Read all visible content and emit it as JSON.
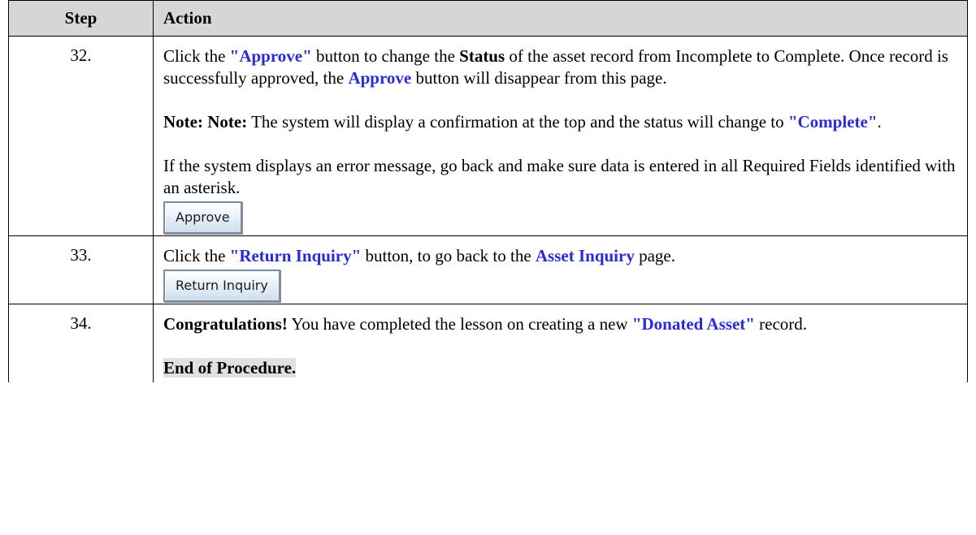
{
  "headers": {
    "step": "Step",
    "action": "Action"
  },
  "rows": [
    {
      "step": "32.",
      "p1": {
        "a": "Click the ",
        "b": "\"Approve\"",
        "c": " button to change the ",
        "d": "Status",
        "e": " of the asset record from Incomplete to Complete. Once record is successfully approved, the ",
        "f": "Approve",
        "g": " button will disappear from this page."
      },
      "note": {
        "a": "Note: Note:",
        "b": " The system will display a confirmation at the top and the status will change to ",
        "c": "\"Complete\"",
        "d": "."
      },
      "p3": "If the system displays an error message, go back and make sure data is entered in all Required Fields identified with an asterisk.",
      "button": "Approve"
    },
    {
      "step": "33.",
      "p1": {
        "a": "Click the ",
        "b": "\"Return Inquiry\"",
        "c": " button, to go back to the ",
        "d": "Asset Inquiry",
        "e": " page."
      },
      "button": "Return Inquiry"
    },
    {
      "step": "34.",
      "p1": {
        "a": "Congratulations!",
        "b": " You have completed the lesson on creating a new ",
        "c": "\"Donated Asset\"",
        "d": " record."
      },
      "end": "End of Procedure."
    }
  ],
  "colors": {
    "header_bg": "#d6d6d6",
    "link_blue": "#2a2ad8",
    "end_highlight": "#e0e0e0"
  }
}
